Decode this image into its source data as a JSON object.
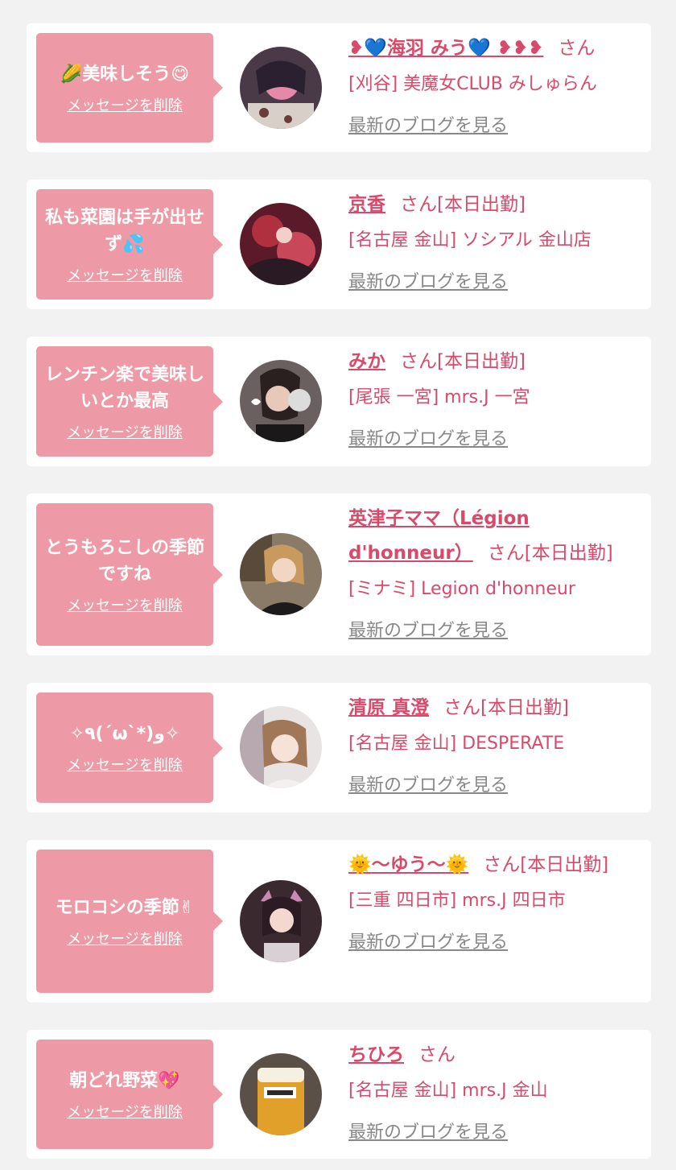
{
  "list": {
    "delete_label": "メッセージを削除",
    "blog_label": "最新のブログを見る",
    "items": [
      {
        "message": "🌽美味しそう😋",
        "name_prefix": "❥💙",
        "name": "海羽 みう",
        "name_suffix_decor": "💙 ❥❥❥",
        "suffix": "さん",
        "shop": "[刈谷] 美魔女CLUB みしゅらん",
        "avatar_icon": "user-avatar"
      },
      {
        "message": "私も菜園は手が出せず💦",
        "name": "京香",
        "suffix": "さん[本日出勤]",
        "shop": "[名古屋 金山] ソシアル 金山店",
        "avatar_icon": "user-avatar"
      },
      {
        "message": "レンチン楽で美味しいとか最高",
        "name": "みか",
        "suffix": "さん[本日出勤]",
        "shop": "[尾張 一宮] mrs.J 一宮",
        "avatar_icon": "user-avatar"
      },
      {
        "message": "とうもろこしの季節ですね",
        "name": "英津子ママ（Légion d'honneur）",
        "suffix": "さん[本日出勤]",
        "shop": "[ミナミ] Legion d'honneur",
        "avatar_icon": "user-avatar"
      },
      {
        "message": "✧٩(ˊωˋ*)و✧",
        "name": "清原 真澄",
        "suffix": "さん[本日出勤]",
        "shop": "[名古屋 金山] DESPERATE",
        "avatar_icon": "user-avatar"
      },
      {
        "message": "モロコシの季節✌",
        "name_prefix": "🌞",
        "name": "〜ゆう〜",
        "name_suffix_decor": "🌞",
        "suffix": "さん[本日出勤]",
        "shop": "[三重 四日市] mrs.J 四日市",
        "avatar_icon": "user-avatar"
      },
      {
        "message": "朝どれ野菜💖",
        "name": "ちひろ",
        "suffix": "さん",
        "shop": "[名古屋 金山] mrs.J 金山",
        "avatar_icon": "user-avatar"
      }
    ]
  }
}
